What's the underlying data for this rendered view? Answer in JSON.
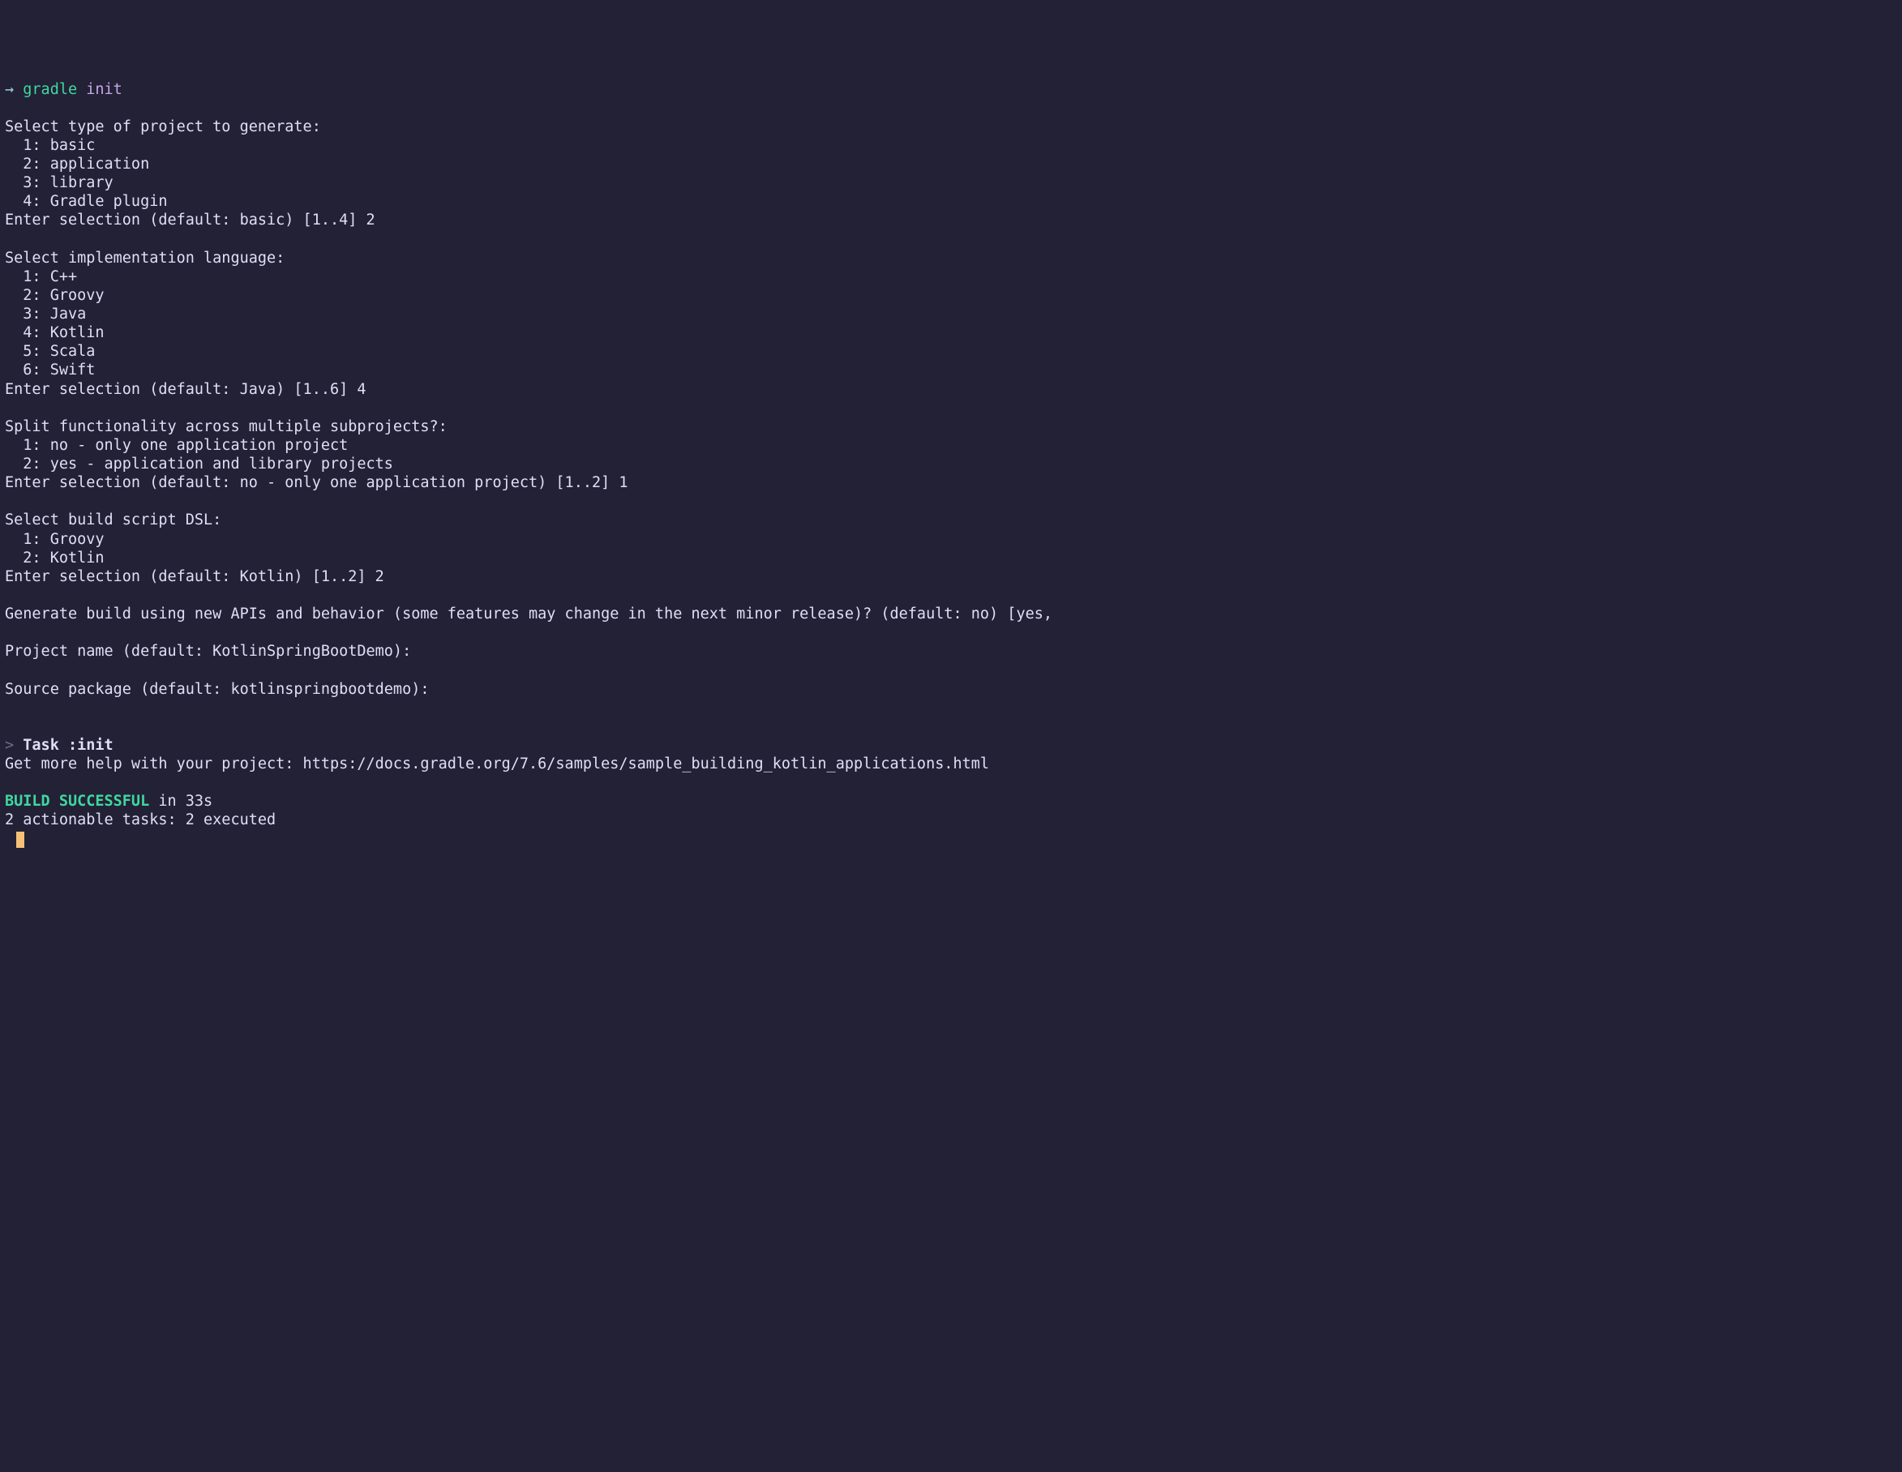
{
  "prompt": {
    "arrow": "→",
    "command": "gradle",
    "arg": "init"
  },
  "q1": {
    "prompt": "Select type of project to generate:",
    "opts": [
      "  1: basic",
      "  2: application",
      "  3: library",
      "  4: Gradle plugin"
    ],
    "entry": "Enter selection (default: basic) [1..4] 2"
  },
  "q2": {
    "prompt": "Select implementation language:",
    "opts": [
      "  1: C++",
      "  2: Groovy",
      "  3: Java",
      "  4: Kotlin",
      "  5: Scala",
      "  6: Swift"
    ],
    "entry": "Enter selection (default: Java) [1..6] 4"
  },
  "q3": {
    "prompt": "Split functionality across multiple subprojects?:",
    "opts": [
      "  1: no - only one application project",
      "  2: yes - application and library projects"
    ],
    "entry": "Enter selection (default: no - only one application project) [1..2] 1"
  },
  "q4": {
    "prompt": "Select build script DSL:",
    "opts": [
      "  1: Groovy",
      "  2: Kotlin"
    ],
    "entry": "Enter selection (default: Kotlin) [1..2] 2"
  },
  "q5": "Generate build using new APIs and behavior (some features may change in the next minor release)? (default: no) [yes,",
  "q6": "Project name (default: KotlinSpringBootDemo):",
  "q7": "Source package (default: kotlinspringbootdemo):",
  "task": {
    "gt": ">",
    "label": "Task :init"
  },
  "help": "Get more help with your project: https://docs.gradle.org/7.6/samples/sample_building_kotlin_applications.html",
  "build": {
    "status": "BUILD SUCCESSFUL",
    "time": " in 33s"
  },
  "tasks_line": "2 actionable tasks: 2 executed"
}
